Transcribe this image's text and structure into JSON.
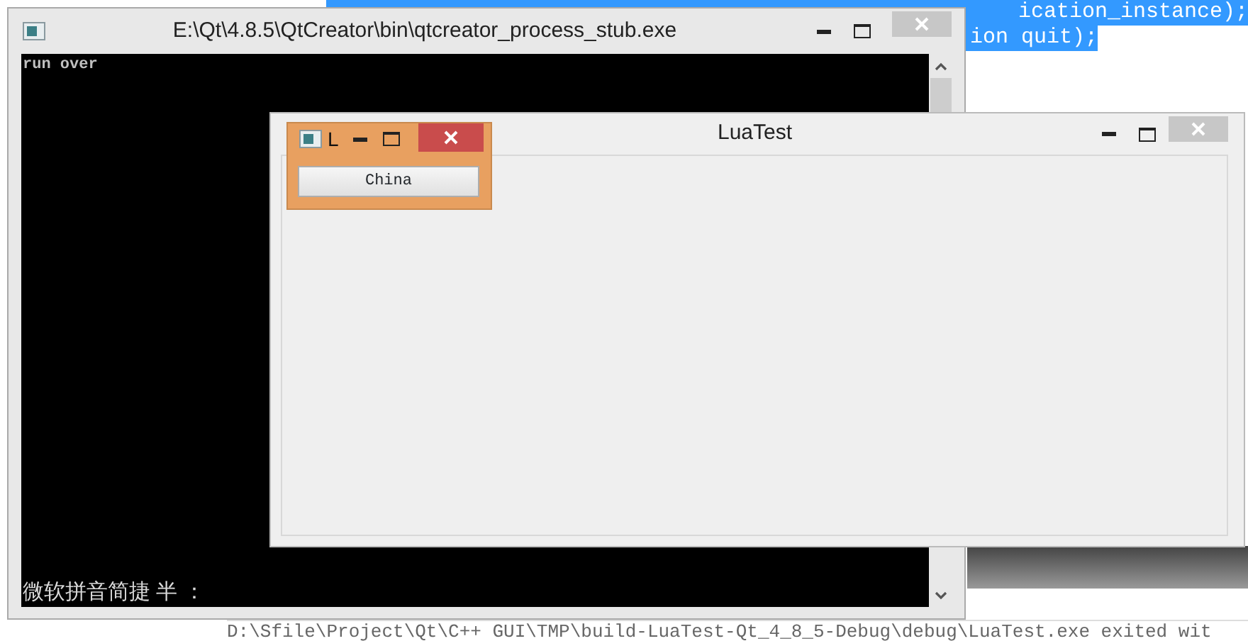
{
  "background_editor": {
    "code_lines": [
      {
        "text": "ication_instance);",
        "selected": true
      },
      {
        "text": "ion quit);",
        "selected": true
      }
    ],
    "output_line": "D:\\Sfile\\Project\\Qt\\C++ GUI\\TMP\\build-LuaTest-Qt_4_8_5-Debug\\debug\\LuaTest.exe exited wit"
  },
  "console_window": {
    "title": "E:\\Qt\\4.8.5\\QtCreator\\bin\\qtcreator_process_stub.exe",
    "lines": [
      "run over"
    ],
    "ime_status": "微软拼音简捷 半 ："
  },
  "main_window": {
    "title": "LuaTest"
  },
  "dialog_window": {
    "title": "L",
    "active": true,
    "buttons": [
      "China"
    ]
  }
}
